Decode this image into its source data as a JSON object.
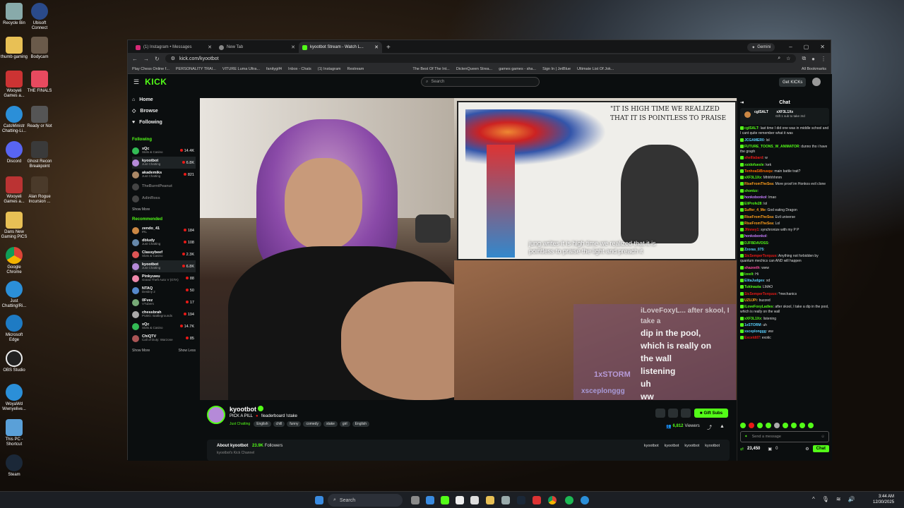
{
  "desktop": {
    "icons": [
      "Recycle Bin",
      "Ubisoft Connect",
      "thumb gaming",
      "Bodycam",
      "Wooyeli Games a...",
      "THE FINALS",
      "CatoMinistr Chatting-Li...",
      "Ready or Not",
      "Discord",
      "Ghost Recon Breakpoint",
      "Wooyeli Games a...",
      "Alan Rogue Incursion ...",
      "Dans New Gaming PICS",
      "Google Chrome",
      "Just Chatting!Ri...",
      "Microsoft Edge",
      "OBS Studio",
      "WoyaWd Wwnyelive...",
      "This PC - Shortcut",
      "Steam"
    ]
  },
  "browser": {
    "tabs": [
      {
        "label": "(1) Instagram • Messages"
      },
      {
        "label": "New Tab"
      },
      {
        "label": "kyootbot Stream - Watch L..."
      }
    ],
    "gemini": "Gemini",
    "url": "kick.com/kyootbot",
    "bookmarks": [
      "Play Chess Online f...",
      "PERSONALITY TRAI...",
      "VITURE Luma Ultra...",
      "fanitygif4",
      "Inbox - Chats",
      "(1) Instagram",
      "Restream",
      "The Best Of The Int...",
      "DictenQueen Strea...",
      "games games - sha...",
      "Sign In | JetBlue",
      "Ultimate List Of Jok..."
    ],
    "all_bookmarks": "All Bookmarks"
  },
  "kick": {
    "logo": "KICK",
    "search_placeholder": "Search",
    "get_kicks": "Get KICKs",
    "nav": [
      "Home",
      "Browse",
      "Following"
    ],
    "following_title": "Following",
    "following": [
      {
        "name": "xQc",
        "game": "Slots & Casino",
        "viewers": "14.4K"
      },
      {
        "name": "kyootbot",
        "game": "Just Chatting",
        "viewers": "6.8K"
      },
      {
        "name": "akademiks",
        "game": "Just Chatting",
        "viewers": "821"
      },
      {
        "name": "TheBurntPeanut",
        "game": "",
        "viewers": ""
      },
      {
        "name": "AdinRoss",
        "game": "",
        "viewers": ""
      }
    ],
    "show_more": "Show More",
    "recommended_title": "Recommended",
    "recommended": [
      {
        "name": "zendo_41",
        "game": "IRL",
        "viewers": "184"
      },
      {
        "name": "dbludy",
        "game": "Just Chatting",
        "viewers": "108"
      },
      {
        "name": "Classybeef",
        "game": "Slots & Casino",
        "viewers": "2.3K"
      },
      {
        "name": "kyootbot",
        "game": "Just Chatting",
        "viewers": "6.8K"
      },
      {
        "name": "Pinkyuwu",
        "game": "Grand Theft Auto V (GTA)",
        "viewers": "88"
      },
      {
        "name": "NTAQ",
        "game": "Destiny 2",
        "viewers": "50"
      },
      {
        "name": "0Fvez",
        "game": "VTubers",
        "viewers": "17"
      },
      {
        "name": "chessbrah",
        "game": "PUBG: Battlegrounds",
        "viewers": "194"
      },
      {
        "name": "xQc",
        "game": "Slots & Casino",
        "viewers": "14.7K"
      },
      {
        "name": "ChiQTV",
        "game": "Call of Duty: Warzone",
        "viewers": "85"
      }
    ],
    "show_more2": "Show More",
    "show_less": "Show Less",
    "video": {
      "card_quote": "\"IT IS HIGH TIME WE REALIZED THAT IT IS POINTLESS TO PRAISE",
      "caption": "jung writes it is high time we realized that it is pointless to praise the light and preach it",
      "chat_overlay": [
        "iLoveFoxyL... after skool, I take a",
        "dip in the pool,",
        "which is really on",
        "the wall",
        "listening",
        "uh",
        "ww"
      ],
      "overlay_names": [
        "1xSTORM",
        "xsceplonggg"
      ]
    },
    "stream": {
      "streamer": "kyootbot",
      "title": "PICK A PILL",
      "title2": "!leaderboard !stake",
      "category": "Just Chatting",
      "tags": [
        "English",
        "chill",
        "funny",
        "comedy",
        "stake",
        "girl",
        "English"
      ],
      "gift_subs": "Gift Subs",
      "viewers": "6,812",
      "viewers_label": "Viewers",
      "about": "About kyootbot",
      "followers": "23.9K",
      "followers_label": "Followers",
      "channel_text": "kyootbot's Kick Channel",
      "socials": [
        "kyootbot",
        "kyootbot",
        "kyootbot",
        "kyootbot"
      ]
    },
    "chat": {
      "title": "Chat",
      "pinned_user": "cgISALT",
      "pinned_target": "xXF3L1Xx",
      "pinned_text": "Gift 1 sub to take 3rd",
      "messages": [
        {
          "user": "cgISALT",
          "color": "#53fc18",
          "text": "last time I did one was in middle school and I cant quite remember what it was"
        },
        {
          "user": "JCGAMER0",
          "color": "#5ad1ff",
          "text": "lol"
        },
        {
          "user": "FUTURE_TOONS_W_ANIMATOR",
          "color": "#53fc18",
          "text": "dunno tho i have the graph"
        },
        {
          "user": "shelllabard",
          "color": "#e91916",
          "text": "w"
        },
        {
          "user": "xsidofuesle",
          "color": "#53fc18",
          "text": "kek"
        },
        {
          "user": "TenhoaSiBrusqu",
          "color": "#ff6a00",
          "text": "main battle trait?"
        },
        {
          "user": "xXF3L1Xx",
          "color": "#53fc18",
          "text": "Mhhhhhmm"
        },
        {
          "user": "RiseFromTheSea",
          "color": "#ff9f1c",
          "text": "More proof im Honkos evil clone"
        },
        {
          "user": "shontzz",
          "color": "#53fc18",
          "text": ""
        },
        {
          "user": "honkobonkol",
          "color": "#c77dff",
          "text": "lmao"
        },
        {
          "user": "EliProfe28",
          "color": "#53fc18",
          "text": "lol"
        },
        {
          "user": "Suffer_4_Me",
          "color": "#ff9f1c",
          "text": "God eating Dragon"
        },
        {
          "user": "RiseFromTheSea",
          "color": "#ff9f1c",
          "text": "Evil universe"
        },
        {
          "user": "RiseFromTheSea",
          "color": "#ff9f1c",
          "text": "Lol"
        },
        {
          "user": "Jfinney1",
          "color": "#e91916",
          "text": "synchronize with my P P"
        },
        {
          "user": "honkobonkol",
          "color": "#c77dff",
          "text": ""
        },
        {
          "user": "DJFBDAVDSS",
          "color": "#53fc18",
          "text": ""
        },
        {
          "user": "Zzoras_075",
          "color": "#5ad1ff",
          "text": ""
        },
        {
          "user": "SicSemperTorquus",
          "color": "#e91916",
          "text": "Anything not forbidden by quantum mechics can AND will happen"
        },
        {
          "user": "shazeeth",
          "color": "#ff4fa3",
          "text": "www"
        },
        {
          "user": "Izeelt",
          "color": "#53fc18",
          "text": "Hi"
        },
        {
          "user": "ElitaJudges",
          "color": "#5ad1ff",
          "text": "xd"
        },
        {
          "user": "Tuklnauta",
          "color": "#53fc18",
          "text": "LMAO"
        },
        {
          "user": "SicSemperTorquus",
          "color": "#e91916",
          "text": "*mechanics"
        },
        {
          "user": "UZUJPi",
          "color": "#ff9f1c",
          "text": "buzzed"
        },
        {
          "user": "iLoveFoxyLadies",
          "color": "#53fc18",
          "text": "after skool, I take a dip in the pool, which is really on the wall"
        },
        {
          "user": "xXF3L1Xx",
          "color": "#53fc18",
          "text": "listening"
        },
        {
          "user": "1xSTORM",
          "color": "#5ad1ff",
          "text": "uh"
        },
        {
          "user": "xsceplonggg",
          "color": "#5ad1ff",
          "text": "ww"
        },
        {
          "user": "Exceldtl7",
          "color": "#e91916",
          "text": "exotic"
        }
      ],
      "input_placeholder": "Send a message",
      "points": "23,450",
      "bits": "0",
      "send": "Chat"
    }
  },
  "taskbar": {
    "search": "Search",
    "time": "3:44 AM",
    "date": "12/30/2025"
  }
}
